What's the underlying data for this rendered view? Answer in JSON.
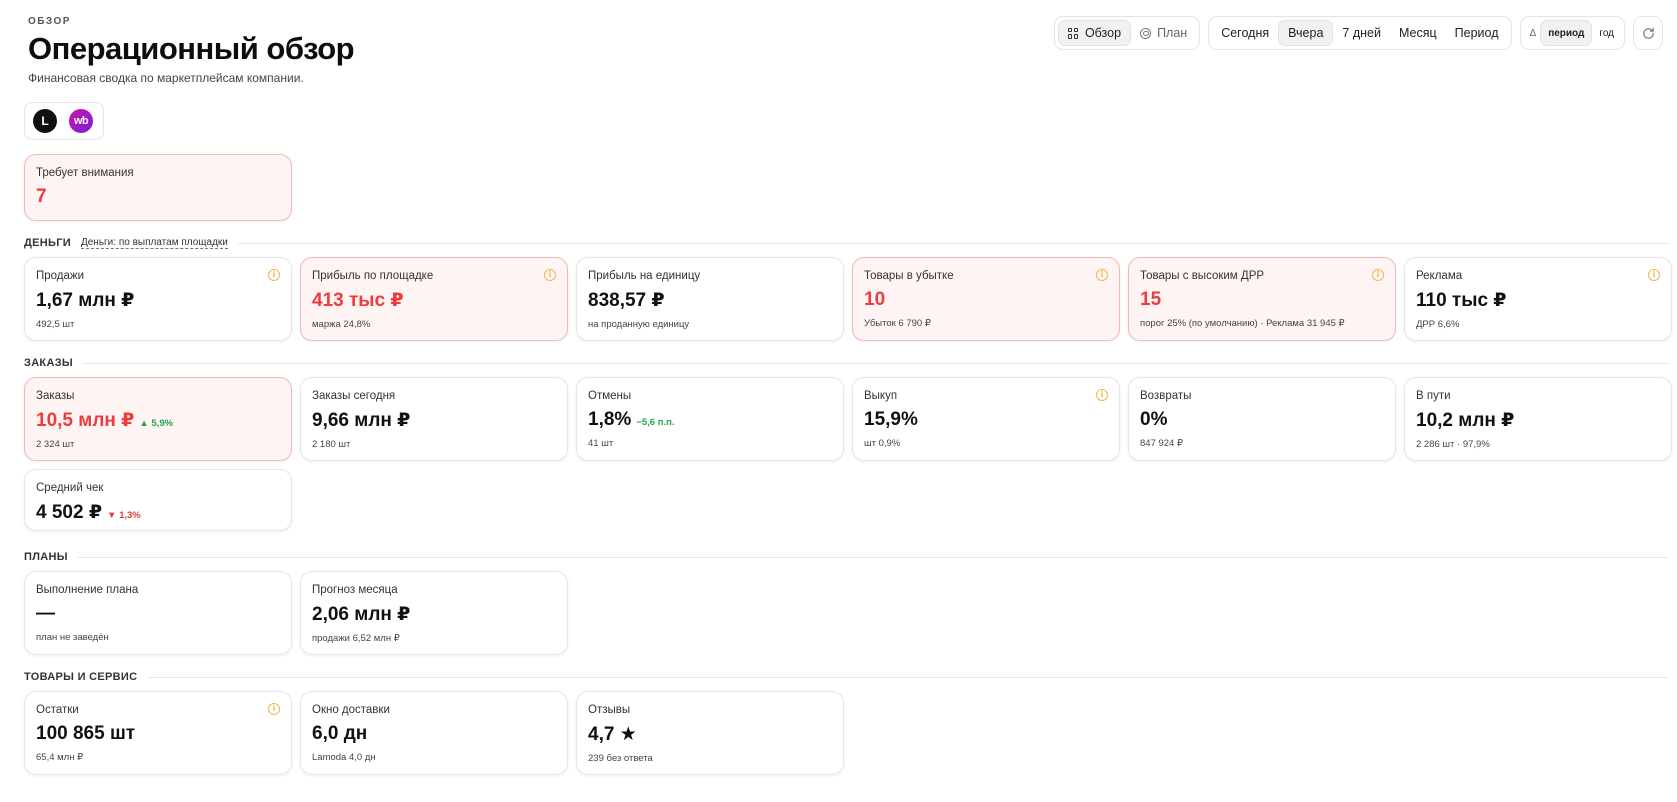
{
  "header": {
    "eyebrow": "ОБЗОР",
    "title": "Операционный обзор",
    "subtitle": "Финансовая сводка по маркетплейсам компании."
  },
  "toolbar": {
    "views": [
      {
        "label": "Обзор",
        "icon": "grid-icon",
        "active": true
      },
      {
        "label": "План",
        "icon": "target-icon",
        "active": false
      }
    ],
    "periods": [
      {
        "label": "Сегодня",
        "active": false
      },
      {
        "label": "Вчера",
        "active": true
      },
      {
        "label": "7 дней",
        "active": false
      },
      {
        "label": "Месяц",
        "active": false
      },
      {
        "label": "Период",
        "active": false
      }
    ],
    "compare_label": "Δ",
    "compare": [
      {
        "label": "период",
        "active": true
      },
      {
        "label": "год",
        "active": false
      }
    ],
    "refresh_icon": "refresh-icon"
  },
  "marketplaces": [
    {
      "label": "L",
      "icon": "lamoda-logo"
    },
    {
      "label": "wb",
      "icon": "wildberries-logo"
    }
  ],
  "attention": {
    "label": "Требует внимания",
    "value": "7"
  },
  "sections": {
    "money": {
      "title": "ДЕНЬГИ",
      "link": "Деньги: по выплатам площадки"
    },
    "orders": {
      "title": "ЗАКАЗЫ"
    },
    "plans": {
      "title": "ПЛАНЫ"
    },
    "goods": {
      "title": "ТОВАРЫ И СЕРВИС"
    }
  },
  "money": [
    {
      "label": "Продажи",
      "value": "1,67 млн ₽",
      "sub": "492,5 шт",
      "alert": false,
      "info": true
    },
    {
      "label": "Прибыль по площадке",
      "value": "413 тыс ₽",
      "sub": "маржа 24,8%",
      "alert": true,
      "info": true
    },
    {
      "label": "Прибыль на единицу",
      "value": "838,57 ₽",
      "sub": "на проданную единицу",
      "alert": false,
      "info": false
    },
    {
      "label": "Товары в убытке",
      "value": "10",
      "sub": "Убыток 6 790 ₽",
      "alert": true,
      "info": true
    },
    {
      "label": "Товары с высоким ДРР",
      "value": "15",
      "sub": "порог 25% (по умолчанию) · Реклама 31 945 ₽",
      "alert": true,
      "info": true
    },
    {
      "label": "Реклама",
      "value": "110 тыс ₽",
      "sub": "ДРР 6,6%",
      "alert": false,
      "info": true
    }
  ],
  "orders": [
    {
      "label": "Заказы",
      "value": "10,5 млн ₽",
      "delta": "▲ 5,9%",
      "delta_dir": "up",
      "sub": "2 324 шт",
      "alert": true,
      "info": false
    },
    {
      "label": "Заказы сегодня",
      "value": "9,66 млн ₽",
      "delta": "",
      "sub": "2 180 шт",
      "alert": false,
      "info": false
    },
    {
      "label": "Отмены",
      "value": "1,8%",
      "delta": "−5,6 п.п.",
      "delta_dir": "up",
      "sub": "41 шт",
      "alert": false,
      "info": false
    },
    {
      "label": "Выкуп",
      "value": "15,9%",
      "delta": "",
      "sub": "шт 0,9%",
      "alert": false,
      "info": true
    },
    {
      "label": "Возвраты",
      "value": "0%",
      "delta": "",
      "sub": "847 924 ₽",
      "alert": false,
      "info": false
    },
    {
      "label": "В пути",
      "value": "10,2 млн ₽",
      "delta": "",
      "sub": "2 286 шт · 97,9%",
      "alert": false,
      "info": false
    },
    {
      "label": "Средний чек",
      "value": "4 502 ₽",
      "delta": "▼ 1,3%",
      "delta_dir": "down",
      "sub": "",
      "alert": false,
      "info": false
    }
  ],
  "plans": [
    {
      "label": "Выполнение плана",
      "value": "—",
      "sub": "план не заведён",
      "alert": false,
      "info": false
    },
    {
      "label": "Прогноз месяца",
      "value": "2,06 млн ₽",
      "sub": "продажи 6,52 млн ₽",
      "alert": false,
      "info": false
    }
  ],
  "goods": [
    {
      "label": "Остатки",
      "value": "100 865 шт",
      "sub": "65,4 млн ₽",
      "alert": false,
      "info": true
    },
    {
      "label": "Окно доставки",
      "value": "6,0 дн",
      "sub": "Lamoda 4,0 дн",
      "alert": false,
      "info": false
    },
    {
      "label": "Отзывы",
      "value": "4,7 ★",
      "sub": "239 без ответа",
      "alert": false,
      "info": false
    }
  ],
  "colors": {
    "alert_bg": "#fff4f4",
    "alert_border": "#f4b7b7",
    "alert_text": "#ee3b3b",
    "up": "#22a652",
    "down": "#e23b3b",
    "info": "#f0b545"
  }
}
